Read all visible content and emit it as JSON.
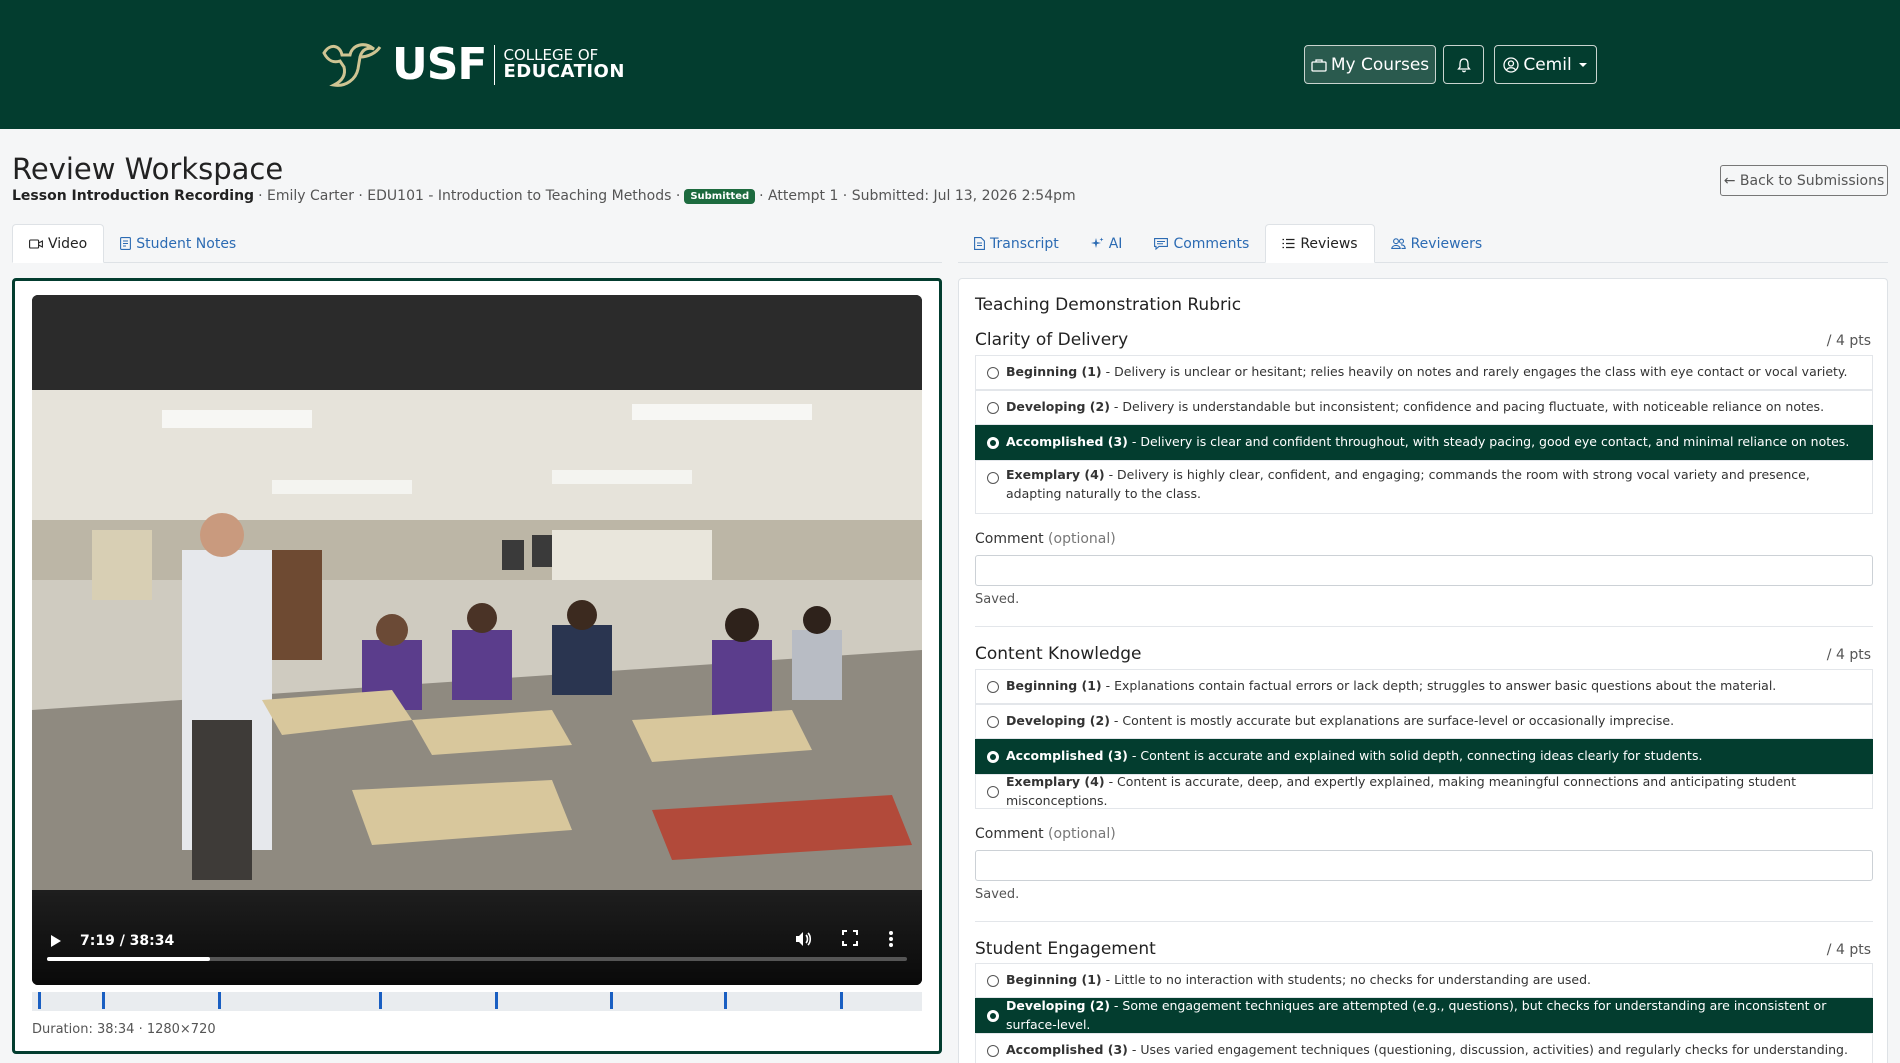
{
  "header": {
    "logo_usf": "USF",
    "logo_line1": "COLLEGE OF",
    "logo_line2": "EDUCATION",
    "my_courses": "My Courses",
    "user": "Cemil"
  },
  "page": {
    "title": "Review Workspace",
    "lesson": "Lesson Introduction Recording",
    "details": "· Emily Carter · EDU101 - Introduction to Teaching Methods ·",
    "badge": "Submitted",
    "attempt": "· Attempt 1 · Submitted: Jul 13, 2026 2:54pm",
    "back": "← Back to Submissions"
  },
  "left_tabs": [
    {
      "label": "Video",
      "icon": "video-icon"
    },
    {
      "label": "Student Notes",
      "icon": "notes-icon"
    }
  ],
  "right_tabs": [
    {
      "label": "Transcript",
      "icon": "document-icon"
    },
    {
      "label": "AI",
      "icon": "sparkle-icon"
    },
    {
      "label": "Comments",
      "icon": "comment-icon"
    },
    {
      "label": "Reviews",
      "icon": "list-icon"
    },
    {
      "label": "Reviewers",
      "icon": "people-icon"
    }
  ],
  "video": {
    "current_time": "7:19 / 38:34",
    "progress": 0.19,
    "marker_positions_fraction": [
      0.007,
      0.079,
      0.209,
      0.39,
      0.52,
      0.649,
      0.778,
      0.908
    ],
    "duration_text": "Duration: 38:34 · 1280×720"
  },
  "rubric": {
    "title": "Teaching Demonstration Rubric",
    "comment_label": "Comment",
    "comment_optional": "(optional)",
    "saved": "Saved.",
    "criteria": [
      {
        "name": "Clarity of Delivery",
        "points": "/ 4 pts",
        "options": [
          {
            "level": "Beginning (1)",
            "text": "- Delivery is unclear or hesitant; relies heavily on notes and rarely engages the class with eye contact or vocal variety."
          },
          {
            "level": "Developing (2)",
            "text": "- Delivery is understandable but inconsistent; confidence and pacing fluctuate, with noticeable reliance on notes."
          },
          {
            "level": "Accomplished (3)",
            "text": "- Delivery is clear and confident throughout, with steady pacing, good eye contact, and minimal reliance on notes."
          },
          {
            "level": "Exemplary (4)",
            "text": "- Delivery is highly clear, confident, and engaging; commands the room with strong vocal variety and presence, adapting naturally to the class."
          }
        ],
        "selected": 2
      },
      {
        "name": "Content Knowledge",
        "points": "/ 4 pts",
        "options": [
          {
            "level": "Beginning (1)",
            "text": "- Explanations contain factual errors or lack depth; struggles to answer basic questions about the material."
          },
          {
            "level": "Developing (2)",
            "text": "- Content is mostly accurate but explanations are surface-level or occasionally imprecise."
          },
          {
            "level": "Accomplished (3)",
            "text": "- Content is accurate and explained with solid depth, connecting ideas clearly for students."
          },
          {
            "level": "Exemplary (4)",
            "text": "- Content is accurate, deep, and expertly explained, making meaningful connections and anticipating student misconceptions."
          }
        ],
        "selected": 2
      },
      {
        "name": "Student Engagement",
        "points": "/ 4 pts",
        "options": [
          {
            "level": "Beginning (1)",
            "text": "- Little to no interaction with students; no checks for understanding are used."
          },
          {
            "level": "Developing (2)",
            "text": "- Some engagement techniques are attempted (e.g., questions), but checks for understanding are inconsistent or surface-level."
          },
          {
            "level": "Accomplished (3)",
            "text": "- Uses varied engagement techniques (questioning, discussion, activities) and regularly checks for understanding."
          }
        ],
        "selected": 1
      }
    ]
  },
  "colors": {
    "brand_green": "#033d2f",
    "link_blue": "#2c6bb3",
    "badge_green": "#1d6b3f",
    "marker_blue": "#1a5fc2"
  }
}
